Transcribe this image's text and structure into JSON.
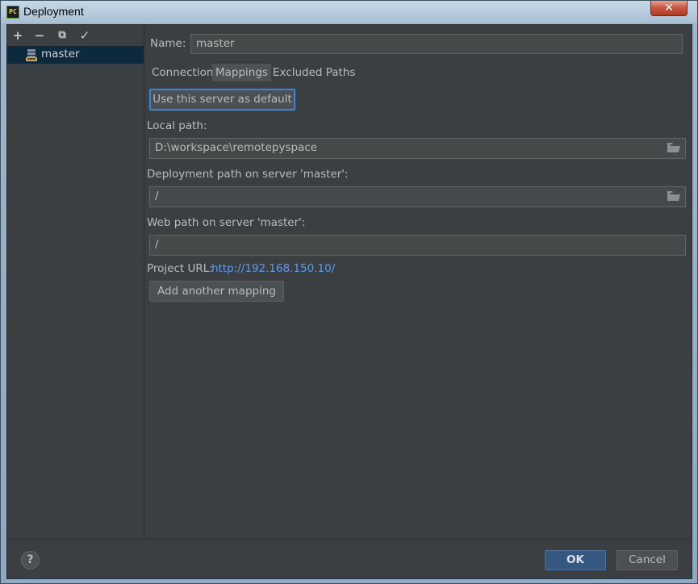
{
  "window": {
    "title": "Deployment",
    "app_icon_text": "PC",
    "close_glyph": "✕"
  },
  "toolbar": {
    "add": "+",
    "remove": "−",
    "copy": "⧉",
    "check": "✓"
  },
  "servers": [
    {
      "label": "master",
      "selected": true
    }
  ],
  "form": {
    "name_label": "Name:",
    "name_value": "master",
    "tabs": [
      {
        "label": "Connection",
        "active": false
      },
      {
        "label": "Mappings",
        "active": true
      },
      {
        "label": "Excluded Paths",
        "active": false
      }
    ],
    "default_button": "Use this server as default",
    "local_path_label": "Local path:",
    "local_path_value": "D:\\workspace\\remotepyspace",
    "deploy_path_label": "Deployment path on server 'master':",
    "deploy_path_value": "/",
    "web_path_label": "Web path on server 'master':",
    "web_path_value": "/",
    "project_url_label": "Project URL:",
    "project_url_value": "http://192.168.150.10/",
    "add_mapping_button": "Add another mapping"
  },
  "footer": {
    "help": "?",
    "ok": "OK",
    "cancel": "Cancel"
  },
  "colors": {
    "background": "#3c3f41",
    "selection": "#0d293e",
    "link": "#589df6",
    "ok_button": "#365880",
    "focus_border": "#4a7ec4"
  },
  "icons": [
    "pycharm-app-icon",
    "close-icon",
    "add-icon",
    "remove-icon",
    "copy-icon",
    "check-icon",
    "sftp-server-icon",
    "folder-icon",
    "help-icon"
  ]
}
